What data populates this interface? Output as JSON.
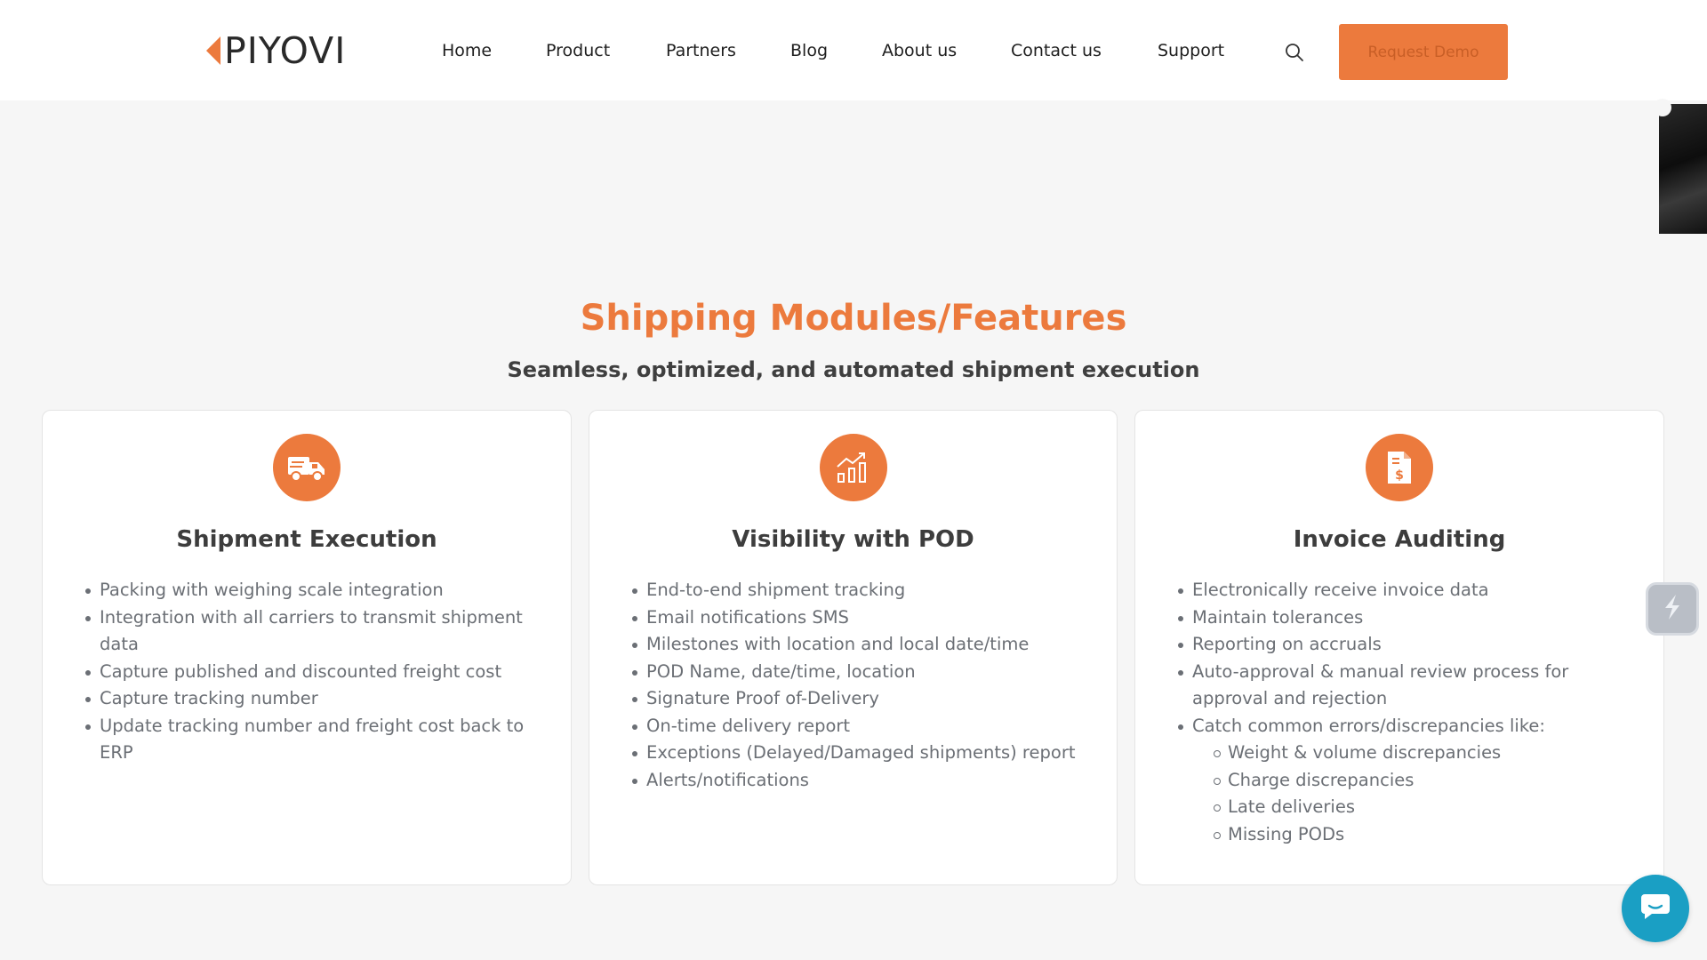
{
  "header": {
    "logo_text": "PIYOVI",
    "nav": [
      {
        "label": "Home"
      },
      {
        "label": "Product"
      },
      {
        "label": "Partners"
      },
      {
        "label": "Blog"
      },
      {
        "label": "About us"
      },
      {
        "label": "Contact us"
      },
      {
        "label": "Support"
      }
    ],
    "cta_label": "Request Demo",
    "search_icon": "search-icon"
  },
  "colors": {
    "accent": "#ec7a3d",
    "chat": "#1a9fc4",
    "text_dark": "#3d3d3d",
    "text_muted": "#6b6f75"
  },
  "section": {
    "title": "Shipping Modules/Features",
    "subtitle": "Seamless, optimized, and automated shipment execution"
  },
  "cards": [
    {
      "icon": "delivery-truck-icon",
      "title": "Shipment Execution",
      "items": [
        "Packing with weighing scale integration",
        "Integration with all carriers to transmit shipment data",
        "Capture published and discounted freight cost",
        "Capture tracking number",
        "Update tracking number and freight cost back to ERP"
      ]
    },
    {
      "icon": "growth-chart-icon",
      "title": "Visibility with POD",
      "items": [
        "End-to-end shipment tracking",
        "Email notifications SMS",
        "Milestones with location and local date/time",
        "POD Name, date/time, location",
        "Signature Proof of-Delivery",
        "On-time delivery report",
        "Exceptions (Delayed/Damaged shipments) report",
        "Alerts/notifications"
      ]
    },
    {
      "icon": "invoice-dollar-icon",
      "title": "Invoice Auditing",
      "items": [
        "Electronically receive invoice data",
        "Maintain tolerances",
        "Reporting on accruals",
        "Auto-approval & manual review process for approval and rejection",
        "Catch common errors/discrepancies like:"
      ],
      "sub_items": [
        "Weight & volume discrepancies",
        "Charge discrepancies",
        "Late deliveries",
        "Missing PODs"
      ]
    }
  ],
  "widgets": {
    "side_widget_icon": "lightning-icon",
    "chat_icon": "chat-bubble-icon"
  }
}
